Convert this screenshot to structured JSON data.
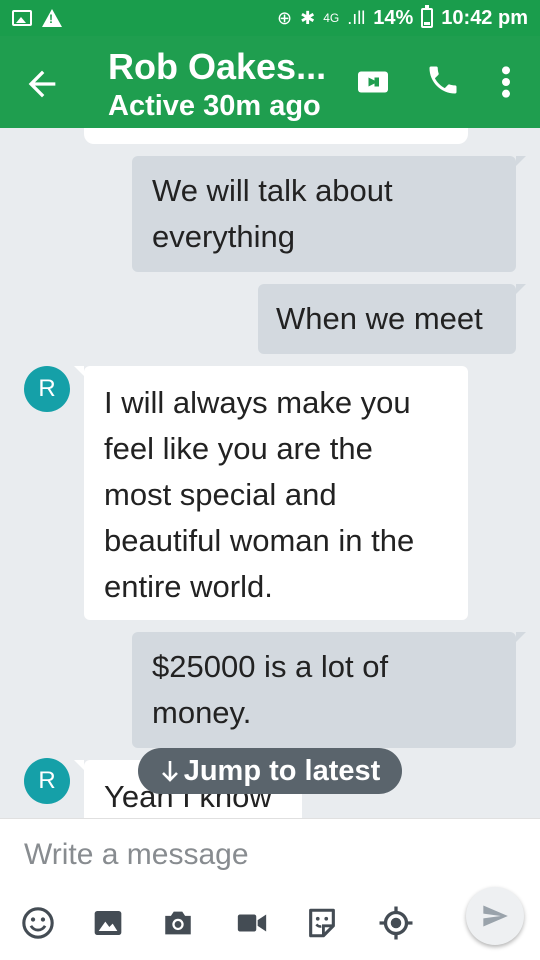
{
  "status_bar": {
    "network": "4G",
    "battery": "14%",
    "time": "10:42 pm"
  },
  "header": {
    "contact_name": "Rob Oakes...",
    "contact_status": "Active 30m ago"
  },
  "messages": [
    {
      "direction": "out",
      "text": "We will talk about everything"
    },
    {
      "direction": "out",
      "text": "When we meet"
    },
    {
      "direction": "in",
      "avatar": "R",
      "text": "I will always make you feel like you are the most special and beautiful woman in the entire world."
    },
    {
      "direction": "out",
      "text": "$25000 is a lot of money."
    },
    {
      "direction": "in",
      "avatar": "R",
      "text": "Yeah I know"
    }
  ],
  "jump_to_latest": "Jump to latest",
  "composer": {
    "placeholder": "Write a message"
  },
  "icons": {
    "accent": "#1f9e4f",
    "avatar_color": "#15a0a8",
    "tools": [
      "emoji-icon",
      "gallery-icon",
      "camera-icon",
      "video-message-icon",
      "sticker-icon",
      "location-icon"
    ]
  }
}
